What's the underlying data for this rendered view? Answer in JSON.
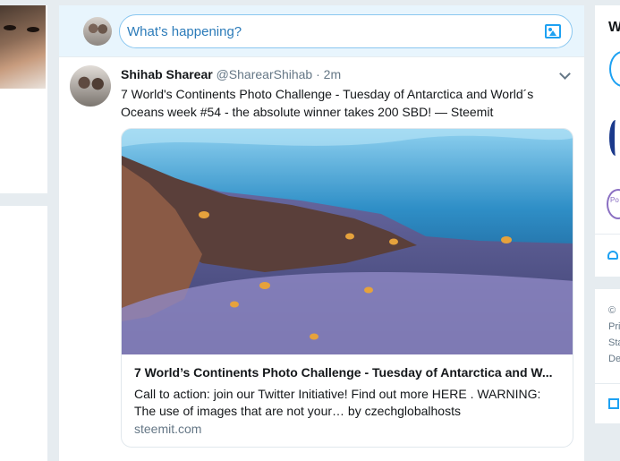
{
  "composer": {
    "placeholder": "What’s happening?"
  },
  "tweet": {
    "name": "Shihab Sharear",
    "handle": "@SharearShihab",
    "dot": "·",
    "time": "2m",
    "text": "7 World's Continents Photo Challenge - Tuesday of Antarctica and World´s Oceans week #54 - the absolute winner takes 200 SBD! — Steemit",
    "card": {
      "title": "7 World’s Continents Photo Challenge - Tuesday of Antarctica and W...",
      "description": "Call to action: join our Twitter Initiative! Find out more HERE . WARNING: The use of images that are not your… by czechglobalhosts",
      "domain": "steemit.com"
    }
  },
  "right_sidebar": {
    "heading": "W",
    "badge_text": "Po P",
    "footer_lines": [
      "©",
      "Pri",
      "Sta",
      "De"
    ]
  },
  "colors": {
    "accent": "#1da1f2",
    "background": "#e6ecf0",
    "composer_bg": "#e8f5fd",
    "secondary_text": "#657786"
  }
}
